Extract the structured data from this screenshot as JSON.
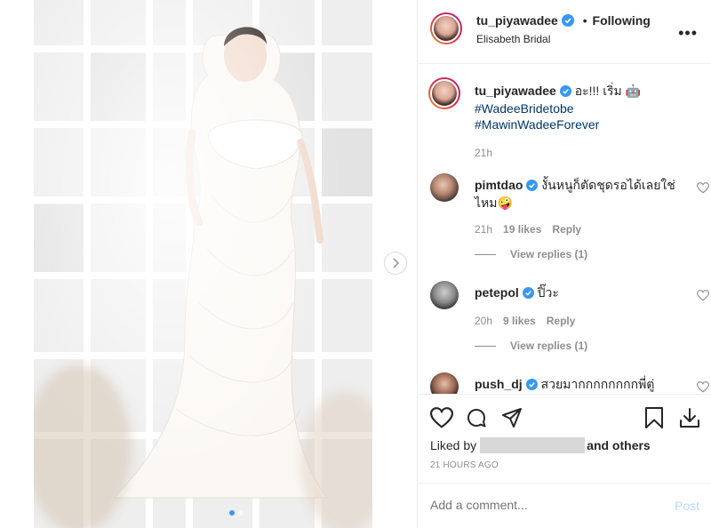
{
  "header": {
    "username": "tu_piyawadee",
    "separator": "•",
    "following_label": "Following",
    "location": "Elisabeth Bridal"
  },
  "caption": {
    "username": "tu_piyawadee",
    "text": "อะ!!! เริ่ม 🤖",
    "hashtag1": "#WadeeBridetobe",
    "hashtag2": "#MawinWadeeForever",
    "time": "21h"
  },
  "comments": [
    {
      "username": "pimtdao",
      "text": "งั้นหนูก็ตัดชุดรอได้เลยใช่ไหม🤪",
      "time": "21h",
      "likes": "19 likes",
      "reply": "Reply",
      "view_replies": "View replies (1)"
    },
    {
      "username": "petepol",
      "text": "ปิ๊วะ",
      "time": "20h",
      "likes": "9 likes",
      "reply": "Reply",
      "view_replies": "View replies (1)"
    },
    {
      "username": "push_dj",
      "text": "สวยมากกกกกกกกพี่ตู่"
    }
  ],
  "actions": {
    "liked_by": "Liked by",
    "and_others": "and others",
    "time_ago": "21 HOURS AGO"
  },
  "add_comment": {
    "placeholder": "Add a comment...",
    "post_label": "Post"
  },
  "icons": [
    "heart-icon",
    "comment-icon",
    "share-icon",
    "bookmark-icon",
    "download-icon",
    "verified-icon",
    "more-icon",
    "chevron-right-icon"
  ],
  "colors": {
    "verified": "#3897f0",
    "hashtag": "#003569",
    "post_disabled": "#b3dbff"
  }
}
